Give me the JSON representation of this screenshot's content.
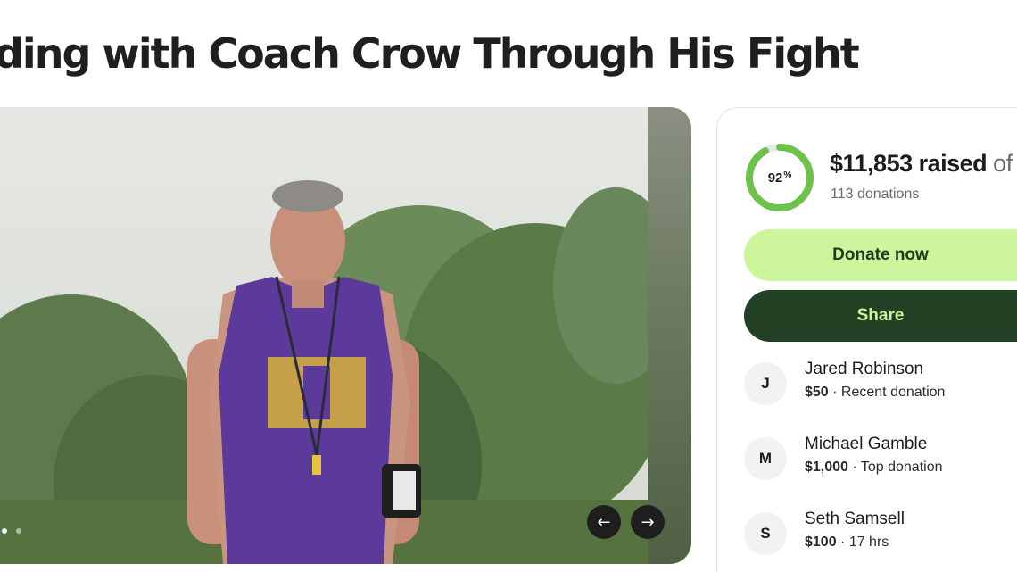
{
  "page": {
    "title": "ding with Coach Crow Through His Fight"
  },
  "carousel": {
    "prev_icon": "arrow-left-icon",
    "next_icon": "arrow-right-icon",
    "prev_glyph": "←",
    "next_glyph": "→"
  },
  "fundraiser": {
    "progress_percent": 92,
    "progress_value": "92",
    "progress_unit": "%",
    "raised_amount": "$11,853 raised",
    "raised_suffix": " of $",
    "donation_count": "113 donations",
    "donate_label": "Donate now",
    "share_label": "Share",
    "colors": {
      "progress": "#6cc24a",
      "progress_track": "#e8e8e8",
      "donate_bg": "#cdf59b",
      "share_bg": "#224125"
    }
  },
  "donors": [
    {
      "initial": "J",
      "name": "Jared Robinson",
      "amount": "$50",
      "note": " · Recent donation"
    },
    {
      "initial": "M",
      "name": "Michael Gamble",
      "amount": "$1,000",
      "note": " · Top donation"
    },
    {
      "initial": "S",
      "name": "Seth Samsell",
      "amount": "$100",
      "note": " · 17 hrs"
    }
  ]
}
